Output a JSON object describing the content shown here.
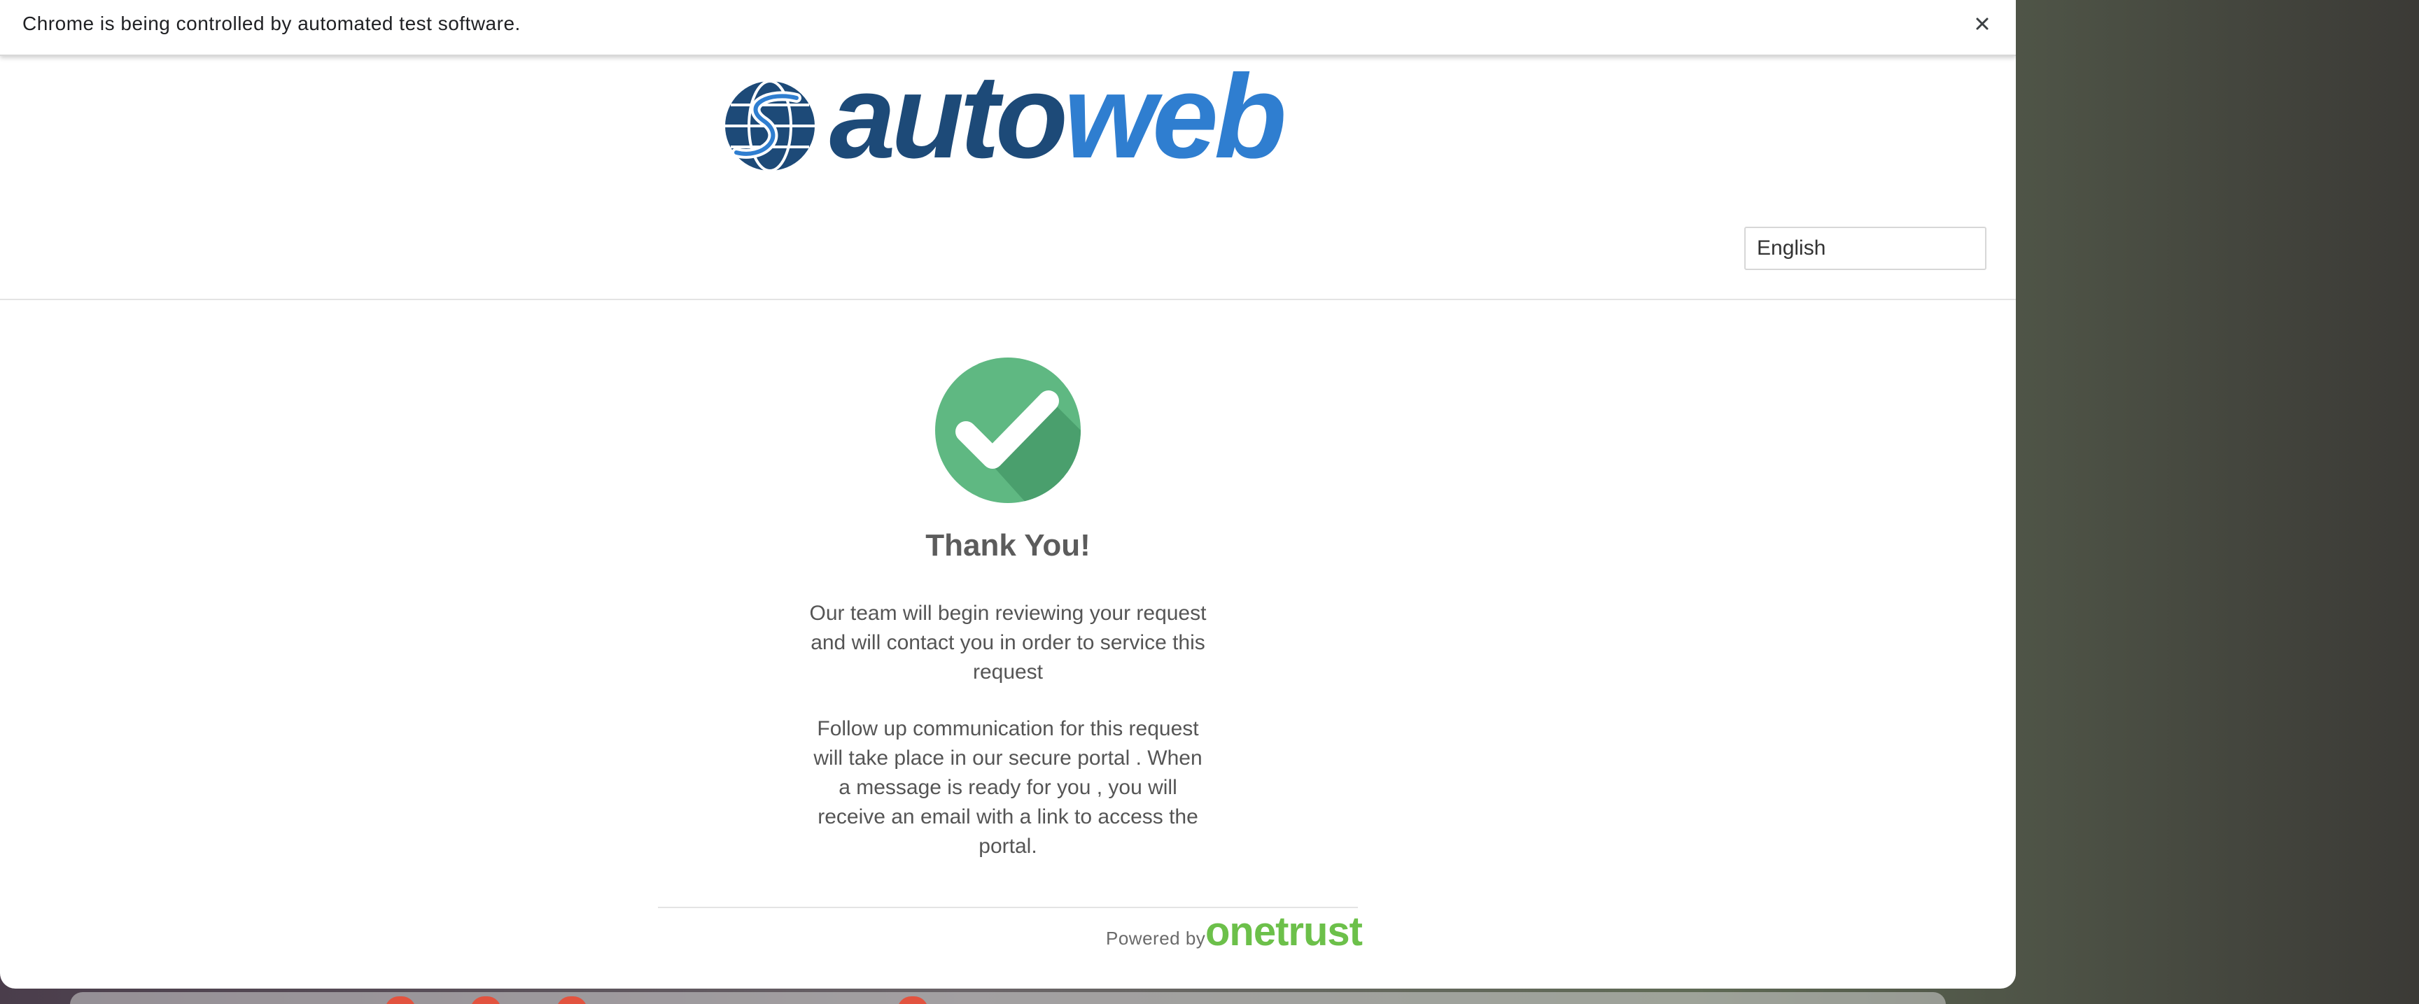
{
  "infobar": {
    "message": "Chrome is being controlled by automated test software.",
    "close_icon": "close-icon"
  },
  "brand": {
    "logo_part1": "auto",
    "logo_part2": "web",
    "colors": {
      "dark_blue": "#1d4a78",
      "light_blue": "#2f7ed0"
    }
  },
  "language_select": {
    "selected": "English"
  },
  "confirmation": {
    "icon": "check-circle-icon",
    "title": "Thank You!",
    "message_1": "Our team will begin reviewing your request and will contact you in order to service this request",
    "message_2": "Follow up communication for this request will take place in our secure portal . When a message is ready for you , you will receive an email with a link to access the portal.",
    "colors": {
      "check_green": "#5fb882",
      "check_shadow": "#4a9f6d"
    }
  },
  "footer": {
    "powered_by": "Powered by",
    "vendor_logo": "onetrust",
    "vendor_color": "#6cc04a"
  }
}
